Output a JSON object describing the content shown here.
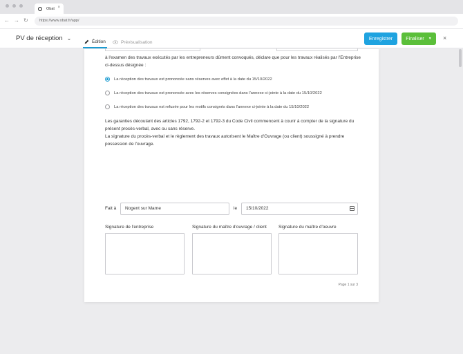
{
  "browser": {
    "tab_title": "Obat",
    "tab_close": "×",
    "url": "https://www.obat.fr/app/"
  },
  "header": {
    "doc_title": "PV de réception",
    "mode_edit": "Édition",
    "mode_preview": "Prévisualisation",
    "save_label": "Enregistrer",
    "finalize_label": "Finaliser",
    "close_label": "×"
  },
  "document": {
    "intro": "à l'examen des travaux exécutés par les entrepreneurs dûment convoqués, déclare que pour les travaux réalisés par l'Entreprise ci-dessus désignée :",
    "options": [
      {
        "label": "La réception des travaux est prononcée sans réserves avec effet à la date du 15/10/2022",
        "checked": true
      },
      {
        "label": "La réception des travaux est prononcée avec les réserves consignées dans l'annexe ci-jointe à la date du 15/10/2022",
        "checked": false
      },
      {
        "label": "La réception des travaux est refusée pour les motifs consignés dans l'annexe ci-jointe à la date du 15/10/2022",
        "checked": false
      }
    ],
    "garanties": "Les garanties découlant des articles 1792, 1792-2 et 1792-3 du Code Civil commencent à courir à compter de la signature du présent procès-verbal, avec ou sans réserve.",
    "signature_text": "La signature du procès-verbal et le règlement des travaux autorisent le Maître d'Ouvrage (ou client) soussigné à prendre possession de l'ouvrage.",
    "fait_a_label": "Fait à",
    "place_value": "Nogent sur Marne",
    "le_label": "le",
    "date_value": "15/10/2022",
    "signatures": [
      "Signature de l'entreprise",
      "Signature du maître d'ouvrage / client",
      "Signature du maître d'oeuvre"
    ],
    "page_number": "Page 1 sur 3"
  },
  "colors": {
    "accent": "#1fa3e0",
    "finalize": "#5bbf3a"
  }
}
